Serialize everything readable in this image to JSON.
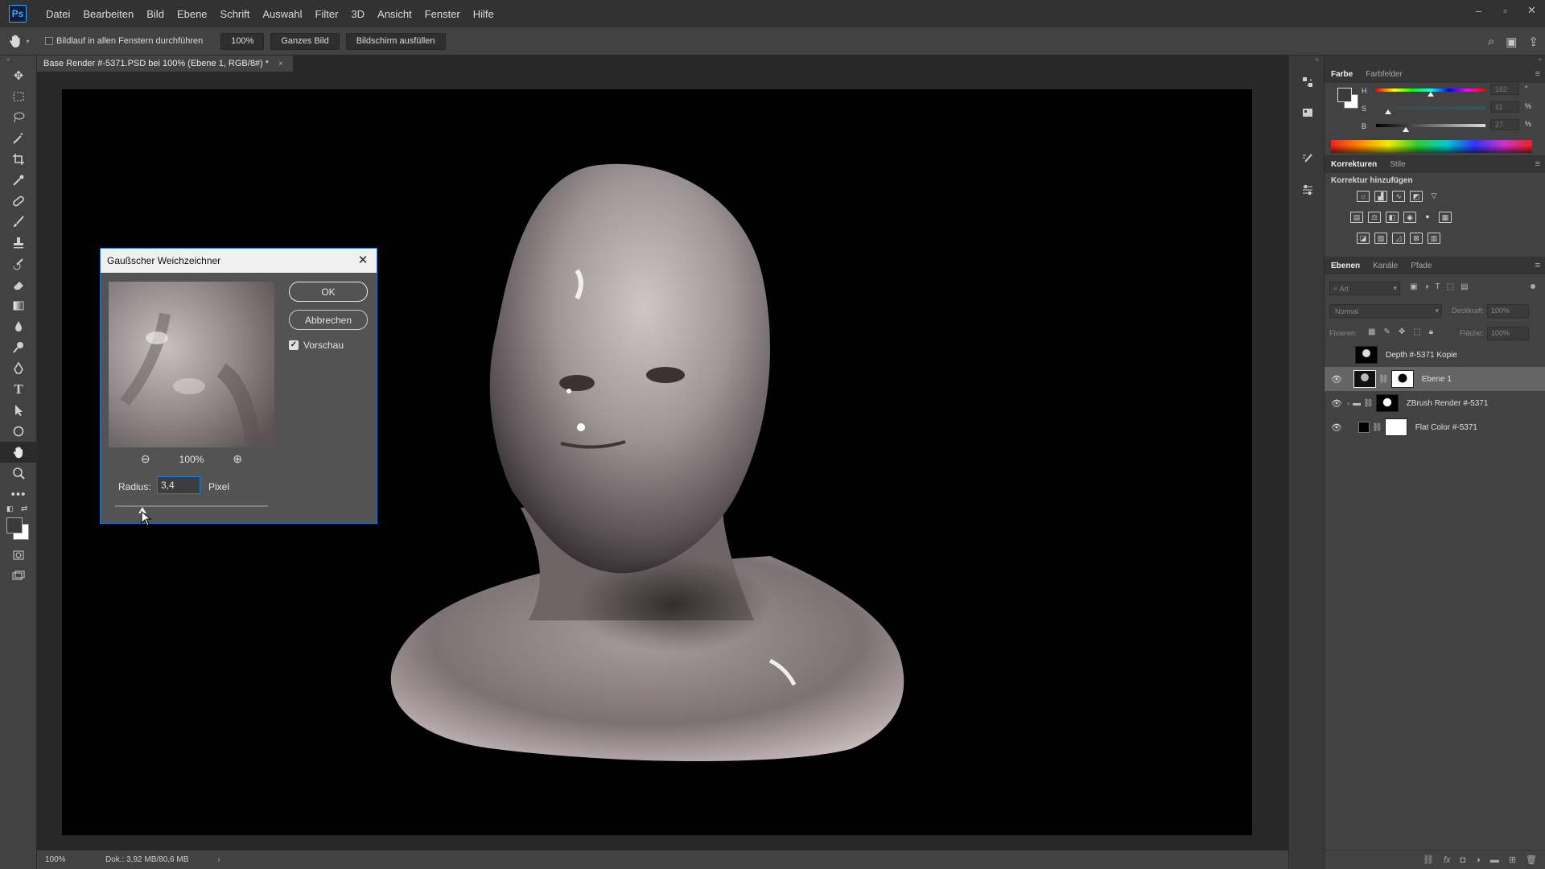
{
  "menu": {
    "logo": "Ps",
    "items": [
      "Datei",
      "Bearbeiten",
      "Bild",
      "Ebene",
      "Schrift",
      "Auswahl",
      "Filter",
      "3D",
      "Ansicht",
      "Fenster",
      "Hilfe"
    ]
  },
  "window_controls": {
    "minimize": "–",
    "maximize": "▫",
    "close": "✕"
  },
  "options_bar": {
    "scroll_all_label": "Bildlauf in allen Fenstern durchführen",
    "zoom_button": "100%",
    "fit_button": "Ganzes Bild",
    "fill_button": "Bildschirm ausfüllen"
  },
  "document": {
    "tab_title": "Base Render #-5371.PSD bei 100% (Ebene 1, RGB/8#) *",
    "tab_close": "×",
    "zoom": "100%",
    "doc_info": "Dok.: 3,92 MB/80,6 MB",
    "status_arrow": "›"
  },
  "dialog": {
    "title": "Gaußscher Weichzeichner",
    "ok_label": "OK",
    "cancel_label": "Abbrechen",
    "preview_label": "Vorschau",
    "preview_checked": true,
    "zoom_value": "100%",
    "radius_label": "Radius:",
    "radius_value": "3,4",
    "radius_unit": "Pixel",
    "radius_slider_fraction": 0.18
  },
  "color_panel": {
    "tabs": [
      "Farbe",
      "Farbfelder"
    ],
    "h_label": "H",
    "h_value": "182",
    "h_unit": "°",
    "s_label": "S",
    "s_value": "11",
    "s_unit": "%",
    "b_label": "B",
    "b_value": "27",
    "b_unit": "%",
    "h_fraction": 0.5,
    "s_fraction": 0.11,
    "b_fraction": 0.27
  },
  "adjustments_panel": {
    "tabs": [
      "Korrekturen",
      "Stile"
    ],
    "heading": "Korrektur hinzufügen"
  },
  "layers_panel": {
    "tabs": [
      "Ebenen",
      "Kanäle",
      "Pfade"
    ],
    "filter_placeholder": "Art",
    "blend_mode": "Normal",
    "opacity_label": "Deckkraft:",
    "opacity_value": "100%",
    "lock_label": "Fixieren:",
    "fill_label": "Fläche:",
    "fill_value": "100%",
    "layers": [
      {
        "name": "Depth #-5371 Kopie",
        "visible": false,
        "selected": false
      },
      {
        "name": "Ebene 1",
        "visible": true,
        "selected": true
      },
      {
        "name": "ZBrush Render #-5371",
        "visible": true,
        "selected": false
      },
      {
        "name": "Flat Color #-5371",
        "visible": true,
        "selected": false
      }
    ]
  },
  "colors": {
    "accent": "#1873d3",
    "ps_blue": "#31a8ff",
    "ui_dark": "#323232",
    "ui_mid": "#424242",
    "ui_light": "#535353",
    "canvas": "#000000"
  }
}
